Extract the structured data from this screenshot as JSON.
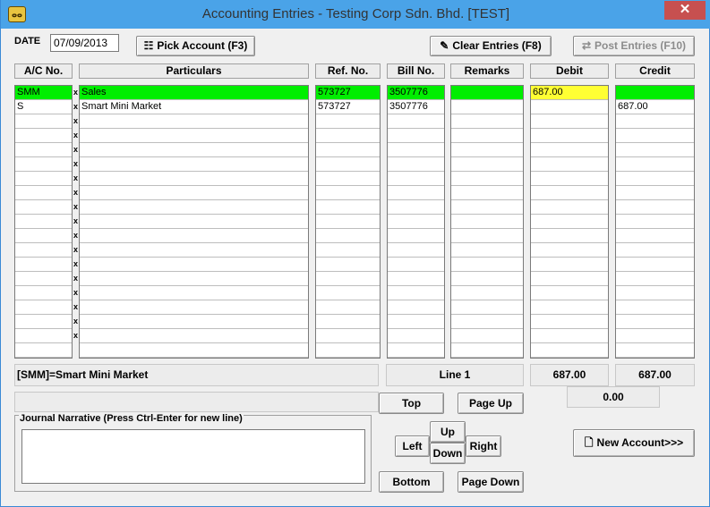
{
  "window": {
    "title": "Accounting Entries - Testing Corp Sdn. Bhd. [TEST]",
    "close": "✕"
  },
  "toolbar": {
    "date_label": "DATE",
    "date_value": "07/09/2013",
    "pick_account": "Pick Account (F3)",
    "clear_entries": "Clear Entries (F8)",
    "post_entries": "Post Entries (F10)"
  },
  "columns": {
    "ac_no": "A/C No.",
    "particulars": "Particulars",
    "ref_no": "Ref. No.",
    "bill_no": "Bill No.",
    "remarks": "Remarks",
    "debit": "Debit",
    "credit": "Credit"
  },
  "rows": [
    {
      "ac_no": "SMM",
      "particulars": "Sales",
      "ref_no": "573727",
      "bill_no": "3507776",
      "remarks": "",
      "debit": "687.00",
      "credit": ""
    },
    {
      "ac_no": "S",
      "particulars": "Smart Mini Market",
      "ref_no": "573727",
      "bill_no": "3507776",
      "remarks": "",
      "debit": "",
      "credit": "687.00"
    }
  ],
  "x_mark": "x",
  "status": {
    "account_info": "[SMM]=Smart Mini Market",
    "line": "Line 1",
    "debit_total": "687.00",
    "credit_total": "687.00",
    "difference": "0.00"
  },
  "narrative": {
    "label": "Journal Narrative (Press Ctrl-Enter for new line)",
    "value": ""
  },
  "navigation": {
    "top": "Top",
    "page_up": "Page Up",
    "up": "Up",
    "left": "Left",
    "down": "Down",
    "right": "Right",
    "bottom": "Bottom",
    "page_down": "Page Down"
  },
  "new_account": "New Account>>>",
  "colors": {
    "selected_row": "#00ee00",
    "active_cell": "#ffff33",
    "title_bar": "#4aa3e8"
  }
}
